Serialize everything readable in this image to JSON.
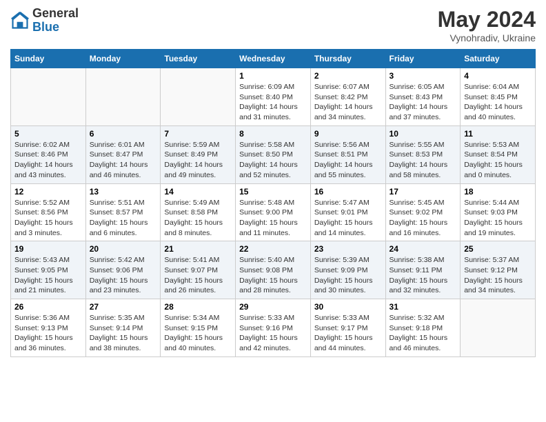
{
  "header": {
    "logo_general": "General",
    "logo_blue": "Blue",
    "month_year": "May 2024",
    "location": "Vynohradiv, Ukraine"
  },
  "weekdays": [
    "Sunday",
    "Monday",
    "Tuesday",
    "Wednesday",
    "Thursday",
    "Friday",
    "Saturday"
  ],
  "weeks": [
    [
      {
        "day": "",
        "info": ""
      },
      {
        "day": "",
        "info": ""
      },
      {
        "day": "",
        "info": ""
      },
      {
        "day": "1",
        "info": "Sunrise: 6:09 AM\nSunset: 8:40 PM\nDaylight: 14 hours\nand 31 minutes."
      },
      {
        "day": "2",
        "info": "Sunrise: 6:07 AM\nSunset: 8:42 PM\nDaylight: 14 hours\nand 34 minutes."
      },
      {
        "day": "3",
        "info": "Sunrise: 6:05 AM\nSunset: 8:43 PM\nDaylight: 14 hours\nand 37 minutes."
      },
      {
        "day": "4",
        "info": "Sunrise: 6:04 AM\nSunset: 8:45 PM\nDaylight: 14 hours\nand 40 minutes."
      }
    ],
    [
      {
        "day": "5",
        "info": "Sunrise: 6:02 AM\nSunset: 8:46 PM\nDaylight: 14 hours\nand 43 minutes."
      },
      {
        "day": "6",
        "info": "Sunrise: 6:01 AM\nSunset: 8:47 PM\nDaylight: 14 hours\nand 46 minutes."
      },
      {
        "day": "7",
        "info": "Sunrise: 5:59 AM\nSunset: 8:49 PM\nDaylight: 14 hours\nand 49 minutes."
      },
      {
        "day": "8",
        "info": "Sunrise: 5:58 AM\nSunset: 8:50 PM\nDaylight: 14 hours\nand 52 minutes."
      },
      {
        "day": "9",
        "info": "Sunrise: 5:56 AM\nSunset: 8:51 PM\nDaylight: 14 hours\nand 55 minutes."
      },
      {
        "day": "10",
        "info": "Sunrise: 5:55 AM\nSunset: 8:53 PM\nDaylight: 14 hours\nand 58 minutes."
      },
      {
        "day": "11",
        "info": "Sunrise: 5:53 AM\nSunset: 8:54 PM\nDaylight: 15 hours\nand 0 minutes."
      }
    ],
    [
      {
        "day": "12",
        "info": "Sunrise: 5:52 AM\nSunset: 8:56 PM\nDaylight: 15 hours\nand 3 minutes."
      },
      {
        "day": "13",
        "info": "Sunrise: 5:51 AM\nSunset: 8:57 PM\nDaylight: 15 hours\nand 6 minutes."
      },
      {
        "day": "14",
        "info": "Sunrise: 5:49 AM\nSunset: 8:58 PM\nDaylight: 15 hours\nand 8 minutes."
      },
      {
        "day": "15",
        "info": "Sunrise: 5:48 AM\nSunset: 9:00 PM\nDaylight: 15 hours\nand 11 minutes."
      },
      {
        "day": "16",
        "info": "Sunrise: 5:47 AM\nSunset: 9:01 PM\nDaylight: 15 hours\nand 14 minutes."
      },
      {
        "day": "17",
        "info": "Sunrise: 5:45 AM\nSunset: 9:02 PM\nDaylight: 15 hours\nand 16 minutes."
      },
      {
        "day": "18",
        "info": "Sunrise: 5:44 AM\nSunset: 9:03 PM\nDaylight: 15 hours\nand 19 minutes."
      }
    ],
    [
      {
        "day": "19",
        "info": "Sunrise: 5:43 AM\nSunset: 9:05 PM\nDaylight: 15 hours\nand 21 minutes."
      },
      {
        "day": "20",
        "info": "Sunrise: 5:42 AM\nSunset: 9:06 PM\nDaylight: 15 hours\nand 23 minutes."
      },
      {
        "day": "21",
        "info": "Sunrise: 5:41 AM\nSunset: 9:07 PM\nDaylight: 15 hours\nand 26 minutes."
      },
      {
        "day": "22",
        "info": "Sunrise: 5:40 AM\nSunset: 9:08 PM\nDaylight: 15 hours\nand 28 minutes."
      },
      {
        "day": "23",
        "info": "Sunrise: 5:39 AM\nSunset: 9:09 PM\nDaylight: 15 hours\nand 30 minutes."
      },
      {
        "day": "24",
        "info": "Sunrise: 5:38 AM\nSunset: 9:11 PM\nDaylight: 15 hours\nand 32 minutes."
      },
      {
        "day": "25",
        "info": "Sunrise: 5:37 AM\nSunset: 9:12 PM\nDaylight: 15 hours\nand 34 minutes."
      }
    ],
    [
      {
        "day": "26",
        "info": "Sunrise: 5:36 AM\nSunset: 9:13 PM\nDaylight: 15 hours\nand 36 minutes."
      },
      {
        "day": "27",
        "info": "Sunrise: 5:35 AM\nSunset: 9:14 PM\nDaylight: 15 hours\nand 38 minutes."
      },
      {
        "day": "28",
        "info": "Sunrise: 5:34 AM\nSunset: 9:15 PM\nDaylight: 15 hours\nand 40 minutes."
      },
      {
        "day": "29",
        "info": "Sunrise: 5:33 AM\nSunset: 9:16 PM\nDaylight: 15 hours\nand 42 minutes."
      },
      {
        "day": "30",
        "info": "Sunrise: 5:33 AM\nSunset: 9:17 PM\nDaylight: 15 hours\nand 44 minutes."
      },
      {
        "day": "31",
        "info": "Sunrise: 5:32 AM\nSunset: 9:18 PM\nDaylight: 15 hours\nand 46 minutes."
      },
      {
        "day": "",
        "info": ""
      }
    ]
  ]
}
